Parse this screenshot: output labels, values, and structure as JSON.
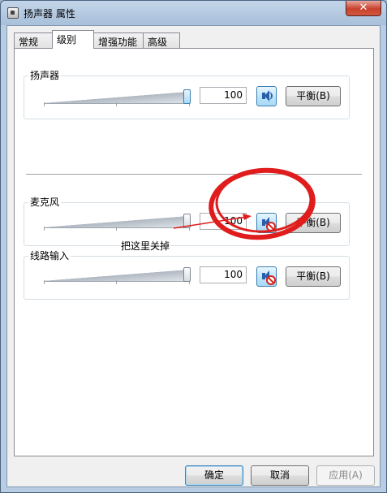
{
  "window": {
    "title": "扬声器 属性",
    "close_glyph": "✕"
  },
  "tabs": [
    {
      "label": "常规",
      "active": false
    },
    {
      "label": "级别",
      "active": true
    },
    {
      "label": "增强功能",
      "active": false
    },
    {
      "label": "高级",
      "active": false
    }
  ],
  "levels": [
    {
      "label": "扬声器",
      "value": "100",
      "muted": false,
      "balance_label": "平衡(B)"
    },
    {
      "label": "麦克风",
      "value": "100",
      "muted": true,
      "balance_label": "平衡(B)"
    },
    {
      "label": "线路输入",
      "value": "100",
      "muted": true,
      "balance_label": "平衡(B)"
    }
  ],
  "annotation": {
    "text": "把这里关掉",
    "color": "#e01c1c"
  },
  "footer": {
    "ok_label": "确定",
    "cancel_label": "取消",
    "apply_label": "应用(A)"
  },
  "icons": {
    "speaker": "speaker-icon",
    "muted": "speaker-muted-icon"
  }
}
